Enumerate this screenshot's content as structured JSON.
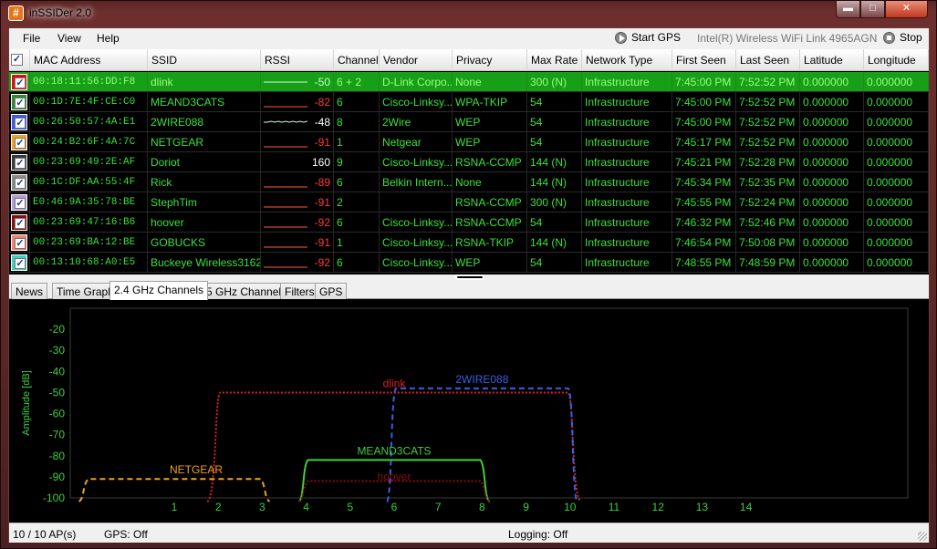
{
  "window": {
    "title": "inSSIDer 2.0",
    "icon": "hash-icon"
  },
  "menu": {
    "file": "File",
    "view": "View",
    "help": "Help"
  },
  "toolbar": {
    "start_gps": "Start GPS",
    "adapter": "Intel(R) Wireless WiFi Link 4965AGN",
    "stop": "Stop"
  },
  "columns": [
    "MAC Address",
    "SSID",
    "RSSI",
    "Channel",
    "Vendor",
    "Privacy",
    "Max Rate",
    "Network Type",
    "First Seen",
    "Last Seen",
    "Latitude",
    "Longitude"
  ],
  "rows": [
    {
      "color": "#e01010",
      "mac": "00:18:11:56:DD:F8",
      "ssid": "dlink",
      "rssi": "-50",
      "channel": "6 + 2",
      "vendor": "D-Link Corpo...",
      "privacy": "None",
      "rate": "300 (N)",
      "type": "Infrastructure",
      "first": "7:45:00 PM",
      "last": "7:52:52 PM",
      "lat": "0.000000",
      "lon": "0.000000"
    },
    {
      "color": "#2e8b2e",
      "mac": "00:1D:7E:4F:CE:C0",
      "ssid": "MEAND3CATS",
      "rssi": "-82",
      "channel": "6",
      "vendor": "Cisco-Linksy...",
      "privacy": "WPA-TKIP",
      "rate": "54",
      "type": "Infrastructure",
      "first": "7:45:00 PM",
      "last": "7:52:52 PM",
      "lat": "0.000000",
      "lon": "0.000000"
    },
    {
      "color": "#3a5ee0",
      "mac": "00:26:50:57:4A:E1",
      "ssid": "2WIRE088",
      "rssi": "-48",
      "channel": "8",
      "vendor": "2Wire",
      "privacy": "WEP",
      "rate": "54",
      "type": "Infrastructure",
      "first": "7:45:00 PM",
      "last": "7:52:52 PM",
      "lat": "0.000000",
      "lon": "0.000000"
    },
    {
      "color": "#f0a020",
      "mac": "00:24:B2:6F:4A:7C",
      "ssid": "NETGEAR",
      "rssi": "-91",
      "channel": "1",
      "vendor": "Netgear",
      "privacy": "WEP",
      "rate": "54",
      "type": "Infrastructure",
      "first": "7:45:17 PM",
      "last": "7:52:52 PM",
      "lat": "0.000000",
      "lon": "0.000000"
    },
    {
      "color": "#3a3a3a",
      "mac": "00:23:69:49:2E:AF",
      "ssid": "Doriot",
      "rssi": "160",
      "channel": "9",
      "vendor": "Cisco-Linksy...",
      "privacy": "RSNA-CCMP",
      "rate": "144 (N)",
      "type": "Infrastructure",
      "first": "7:45:21 PM",
      "last": "7:52:28 PM",
      "lat": "0.000000",
      "lon": "0.000000"
    },
    {
      "color": "#8a8a8a",
      "mac": "00:1C:DF:AA:55:4F",
      "ssid": "Rick",
      "rssi": "-89",
      "channel": "6",
      "vendor": "Belkin Intern...",
      "privacy": "None",
      "rate": "144 (N)",
      "type": "Infrastructure",
      "first": "7:45:34 PM",
      "last": "7:52:35 PM",
      "lat": "0.000000",
      "lon": "0.000000"
    },
    {
      "color": "#b59ad6",
      "mac": "E0:46:9A:35:78:BE",
      "ssid": "StephTim",
      "rssi": "-91",
      "channel": "2",
      "vendor": "",
      "privacy": "RSNA-CCMP",
      "rate": "300 (N)",
      "type": "Infrastructure",
      "first": "7:45:55 PM",
      "last": "7:52:24 PM",
      "lat": "0.000000",
      "lon": "0.000000"
    },
    {
      "color": "#8b0d0d",
      "mac": "00:23:69:47:16:B6",
      "ssid": "hoover",
      "rssi": "-92",
      "channel": "6",
      "vendor": "Cisco-Linksy...",
      "privacy": "RSNA-CCMP",
      "rate": "54",
      "type": "Infrastructure",
      "first": "7:46:32 PM",
      "last": "7:52:46 PM",
      "lat": "0.000000",
      "lon": "0.000000"
    },
    {
      "color": "#f08070",
      "mac": "00:23:69:BA:12:BE",
      "ssid": "GOBUCKS",
      "rssi": "-91",
      "channel": "1",
      "vendor": "Cisco-Linksy...",
      "privacy": "RSNA-TKIP",
      "rate": "144 (N)",
      "type": "Infrastructure",
      "first": "7:46:54 PM",
      "last": "7:50:08 PM",
      "lat": "0.000000",
      "lon": "0.000000"
    },
    {
      "color": "#40d0c0",
      "mac": "00:13:10:68:A0:E5",
      "ssid": "Buckeye Wireless3162",
      "rssi": "-92",
      "channel": "6",
      "vendor": "Cisco-Linksy...",
      "privacy": "WEP",
      "rate": "54",
      "type": "Infrastructure",
      "first": "7:48:55 PM",
      "last": "7:48:59 PM",
      "lat": "0.000000",
      "lon": "0.000000"
    }
  ],
  "tabs": [
    "News",
    "Time Graph",
    "2.4 GHz Channels",
    "5 GHz Channels",
    "Filters",
    "GPS"
  ],
  "active_tab": "2.4 GHz Channels",
  "chart_data": {
    "type": "area",
    "ylabel": "Amplitude [dB]",
    "ylim": [
      -100,
      -10
    ],
    "yticks": [
      -20,
      -30,
      -40,
      -50,
      -60,
      -70,
      -80,
      -90,
      -100
    ],
    "xticks": [
      1,
      2,
      3,
      4,
      5,
      6,
      7,
      8,
      9,
      10,
      11,
      12,
      13,
      14
    ],
    "grid": false,
    "series": [
      {
        "name": "dlink",
        "channel": 6,
        "width": 40,
        "amplitude": -50,
        "color": "#e02020",
        "dash": "2,2"
      },
      {
        "name": "2WIRE088",
        "channel": 8,
        "width": 20,
        "amplitude": -48,
        "color": "#3a5ee0",
        "dash": "6,4"
      },
      {
        "name": "NETGEAR",
        "channel": 1,
        "width": 20,
        "amplitude": -91,
        "color": "#f0a020",
        "dash": "6,4"
      },
      {
        "name": "MEAND3CATS",
        "channel": 6,
        "width": 20,
        "amplitude": -82,
        "color": "#3ecf3e",
        "dash": ""
      },
      {
        "name": "hoover",
        "channel": 6,
        "width": 20,
        "amplitude": -92,
        "color": "#8b0d0d",
        "dash": "2,2"
      }
    ]
  },
  "status": {
    "ap_count": "10 / 10 AP(s)",
    "gps": "GPS: Off",
    "logging": "Logging: Off"
  }
}
